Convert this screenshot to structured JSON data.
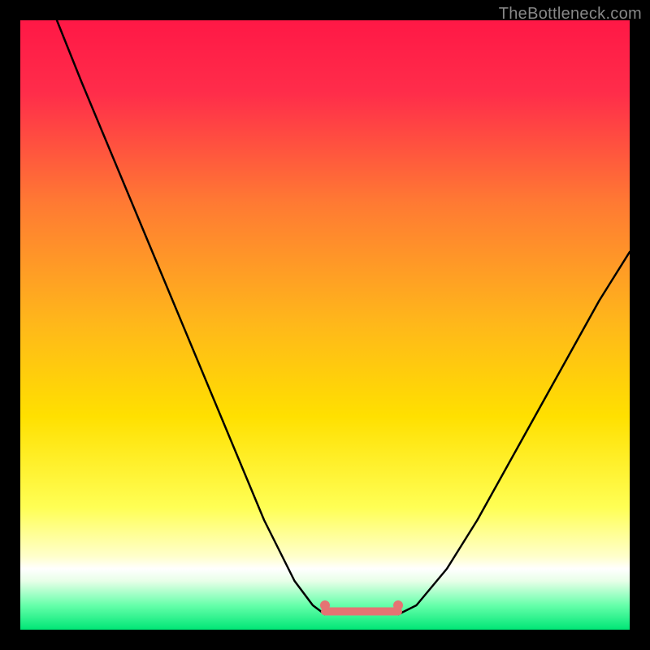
{
  "watermark": "TheBottleneck.com",
  "chart_data": {
    "type": "line",
    "title": "",
    "xlabel": "",
    "ylabel": "",
    "xlim": [
      0,
      100
    ],
    "ylim": [
      0,
      100
    ],
    "background_gradient": {
      "top": "#ff1744",
      "mid_upper": "#ff6633",
      "mid": "#ffcc00",
      "mid_lower": "#ffff66",
      "bottom": "#00e676",
      "white_band_y": 83
    },
    "series": [
      {
        "name": "curve",
        "type": "line",
        "color": "#000000",
        "x": [
          6,
          10,
          15,
          20,
          25,
          30,
          35,
          40,
          45,
          48,
          50,
          52,
          54,
          56,
          58,
          60,
          62,
          65,
          70,
          75,
          80,
          85,
          90,
          95,
          100
        ],
        "y": [
          0,
          10,
          22,
          34,
          46,
          58,
          70,
          82,
          92,
          96,
          97.5,
          97.5,
          97.5,
          97.5,
          97.5,
          97.5,
          97.5,
          96,
          90,
          82,
          73,
          64,
          55,
          46,
          38
        ]
      },
      {
        "name": "flat-bottom-marker",
        "type": "line",
        "color": "#e57373",
        "thickness": 10,
        "x": [
          50,
          62
        ],
        "y": [
          97,
          97
        ]
      },
      {
        "name": "marker-left-dot",
        "type": "scatter",
        "color": "#e57373",
        "x": [
          50
        ],
        "y": [
          96
        ]
      },
      {
        "name": "marker-right-dot",
        "type": "scatter",
        "color": "#e57373",
        "x": [
          62
        ],
        "y": [
          96
        ]
      }
    ]
  }
}
